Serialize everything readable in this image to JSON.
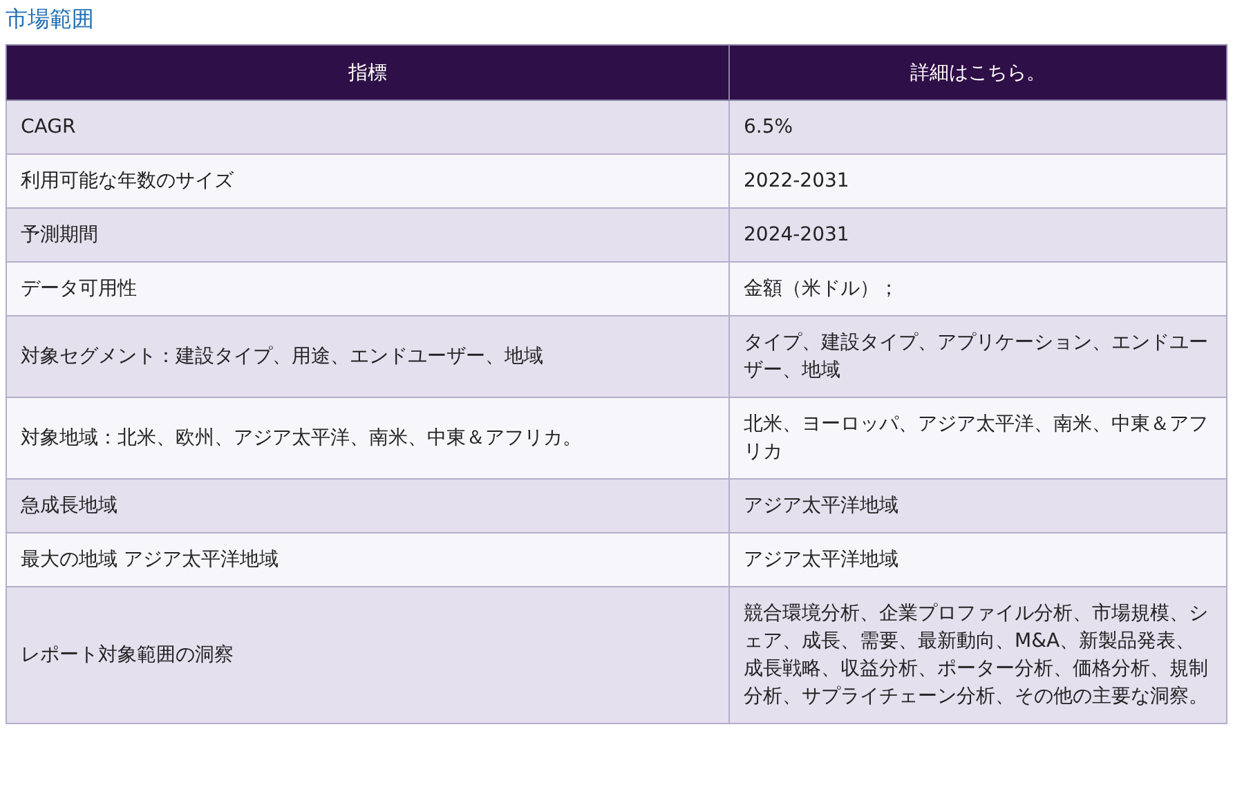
{
  "title": "市場範囲",
  "table": {
    "columns": [
      "指標",
      "詳細はこちら。"
    ],
    "rows": [
      [
        "CAGR",
        "6.5%"
      ],
      [
        "利用可能な年数のサイズ",
        "2022-2031"
      ],
      [
        "予測期間",
        "2024-2031"
      ],
      [
        "データ可用性",
        "金額（米ドル）；"
      ],
      [
        "対象セグメント：建設タイプ、用途、エンドユーザー、地域",
        "タイプ、建設タイプ、アプリケーション、エンドユーザー、地域"
      ],
      [
        "対象地域：北米、欧州、アジア太平洋、南米、中東＆アフリカ。",
        "北米、ヨーロッパ、アジア太平洋、南米、中東＆アフリカ"
      ],
      [
        "急成長地域",
        "アジア太平洋地域"
      ],
      [
        "最大の地域 アジア太平洋地域",
        "アジア太平洋地域"
      ],
      [
        "レポート対象範囲の洞察",
        "競合環境分析、企業プロファイル分析、市場規模、シェア、成長、需要、最新動向、M&A、新製品発表、成長戦略、収益分析、ポーター分析、価格分析、規制分析、サプライチェーン分析、その他の主要な洞察。"
      ]
    ]
  }
}
